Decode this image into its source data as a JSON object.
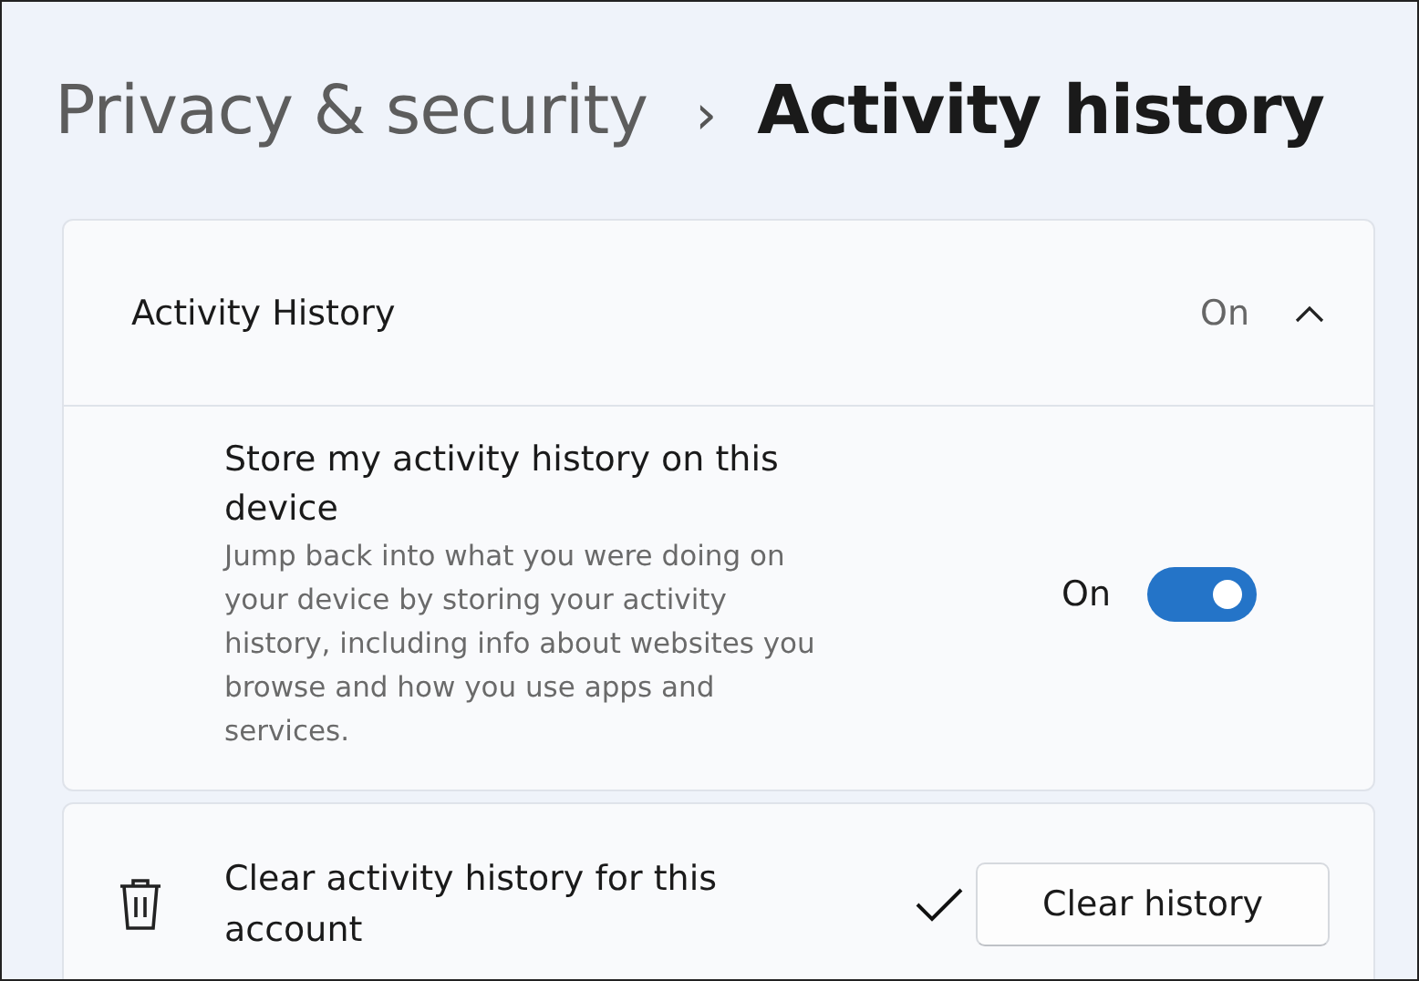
{
  "breadcrumb": {
    "parent": "Privacy & security",
    "separator": "›",
    "current": "Activity history"
  },
  "section": {
    "title": "Activity History",
    "status": "On",
    "expanded": true
  },
  "setting": {
    "title": "Store my activity history on this device",
    "description": "Jump back into what you were doing on your device by storing your activity history, including info about websites you browse and how you use apps and services.",
    "state_label": "On",
    "on": true
  },
  "clear": {
    "title": "Clear activity history for this account",
    "done": true,
    "button": "Clear history"
  }
}
